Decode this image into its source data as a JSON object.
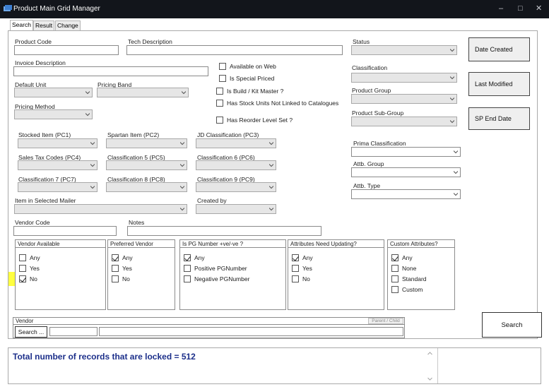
{
  "window": {
    "title": "Product Main Grid Manager"
  },
  "tabs": [
    "Search",
    "Result",
    "Change"
  ],
  "fields": {
    "product_code": {
      "label": "Product Code",
      "value": ""
    },
    "tech_description": {
      "label": "Tech Description",
      "value": ""
    },
    "invoice_description": {
      "label": "Invoice Description",
      "value": ""
    },
    "default_unit": {
      "label": "Default Unit",
      "value": ""
    },
    "pricing_band": {
      "label": "Pricing Band",
      "value": ""
    },
    "pricing_method": {
      "label": "Pricing Method",
      "value": ""
    },
    "status": {
      "label": "Status",
      "value": ""
    },
    "classification": {
      "label": "Classification",
      "value": ""
    },
    "product_group": {
      "label": "Product Group",
      "value": ""
    },
    "product_sub_group": {
      "label": "Product Sub-Group",
      "value": ""
    },
    "prima_classification": {
      "label": "Prima Classification",
      "value": ""
    },
    "attb_group": {
      "label": "Attb. Group",
      "value": ""
    },
    "attb_type": {
      "label": "Attb. Type",
      "value": ""
    },
    "stocked_item": {
      "label": "Stocked Item (PC1)",
      "value": ""
    },
    "spartan_item": {
      "label": "Spartan Item (PC2)",
      "value": ""
    },
    "jd_classification": {
      "label": "JD Classification (PC3)",
      "value": ""
    },
    "sales_tax_codes": {
      "label": "Sales Tax Codes (PC4)",
      "value": ""
    },
    "classification5": {
      "label": "Classification 5 (PC5)",
      "value": ""
    },
    "classification6": {
      "label": "Classification 6 (PC6)",
      "value": ""
    },
    "classification7": {
      "label": "Classification 7 (PC7)",
      "value": ""
    },
    "classification8": {
      "label": "Classification 8 (PC8)",
      "value": ""
    },
    "classification9": {
      "label": "Classification 9 (PC9)",
      "value": ""
    },
    "item_in_selected_mailer": {
      "label": "Item in Selected Mailer",
      "value": ""
    },
    "created_by": {
      "label": "Created by",
      "value": ""
    },
    "vendor_code": {
      "label": "Vendor Code",
      "value": ""
    },
    "notes": {
      "label": "Notes",
      "value": ""
    }
  },
  "flags": [
    {
      "label": "Available on Web",
      "checked": false
    },
    {
      "label": "Is Special Priced",
      "checked": false
    },
    {
      "label": "Is Build / Kit Master ?",
      "checked": false
    },
    {
      "label": "Has Stock Units Not Linked to Catalogues",
      "checked": false
    },
    {
      "label": "Has Reorder Level Set ?",
      "checked": false
    }
  ],
  "groups": {
    "vendor_available": {
      "title": "Vendor Available",
      "options": [
        {
          "label": "Any",
          "checked": false
        },
        {
          "label": "Yes",
          "checked": false
        },
        {
          "label": "No",
          "checked": true
        }
      ]
    },
    "preferred_vendor": {
      "title": "Preferred Vendor",
      "options": [
        {
          "label": "Any",
          "checked": true
        },
        {
          "label": "Yes",
          "checked": false
        },
        {
          "label": "No",
          "checked": false
        }
      ]
    },
    "pg_number": {
      "title": "Is PG Number +ve/-ve ?",
      "options": [
        {
          "label": "Any",
          "checked": true
        },
        {
          "label": "Positive PGNumber",
          "checked": false
        },
        {
          "label": "Negative PGNumber",
          "checked": false
        }
      ]
    },
    "attributes_need_updating": {
      "title": "Attributes Need Updating?",
      "options": [
        {
          "label": "Any",
          "checked": true
        },
        {
          "label": "Yes",
          "checked": false
        },
        {
          "label": "No",
          "checked": false
        }
      ]
    },
    "custom_attributes": {
      "title": "Custom Attributes?",
      "options": [
        {
          "label": "Any",
          "checked": true
        },
        {
          "label": "None",
          "checked": false
        },
        {
          "label": "Standard",
          "checked": false
        },
        {
          "label": "Custom",
          "checked": false
        }
      ]
    }
  },
  "side_buttons": {
    "date_created": "Date Created",
    "last_modified": "Last Modified",
    "sp_end_date": "SP End Date"
  },
  "vendor_box": {
    "title": "Vendor",
    "search_button": "Search ...",
    "parent_child": "Parent / Child"
  },
  "search_button": "Search",
  "status_message": "Total number of records that are locked = 512",
  "colors": {
    "titlebar": "#12151b",
    "status_text": "#1c2f8a",
    "highlight": "#ffff3f"
  },
  "icons": {
    "app": "app-icon",
    "minimize": "minimize-icon",
    "maximize": "maximize-icon",
    "close": "close-icon",
    "dropdown": "chevron-down-icon"
  }
}
